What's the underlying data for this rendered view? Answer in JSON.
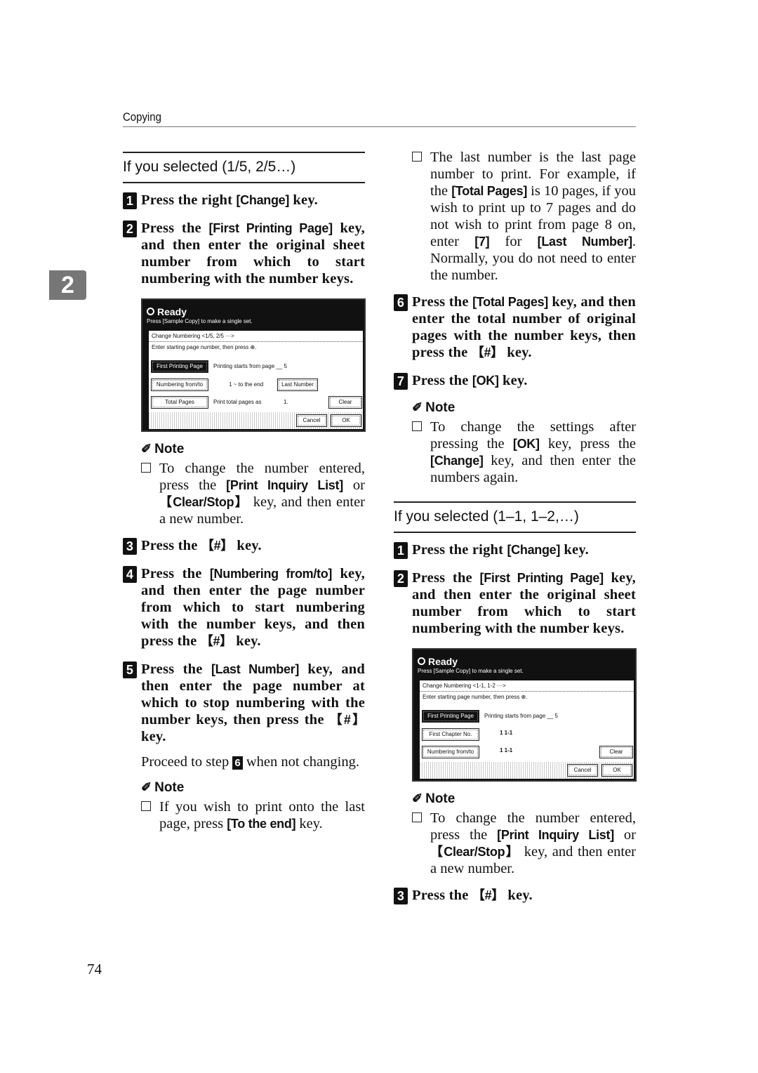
{
  "header": {
    "section": "Copying",
    "chapter_tab": "2",
    "page_number": "74"
  },
  "left": {
    "section_title": "If you selected (1/5, 2/5…)",
    "steps": [
      {
        "num": "1",
        "text": [
          {
            "t": "Press the right "
          },
          {
            "t": "[Change]",
            "k": 1
          },
          {
            "t": " key."
          }
        ]
      },
      {
        "num": "2",
        "text": [
          {
            "t": "Press the "
          },
          {
            "t": "[First Printing Page]",
            "k": 1
          },
          {
            "t": " key, and then enter the original sheet number from which to start numbering with the number keys."
          }
        ]
      }
    ],
    "screen": {
      "status": "Ready",
      "hint": "Press [Sample Copy] to make a single set.",
      "title": "Change Numbering   <1/5, 2/5 ···>",
      "instruction": "Enter starting page number, then press ⊕.",
      "btn_first": "First Printing Page",
      "start_text": "Printing starts from page  __ 5",
      "btn_numbering": "Numbering from/to",
      "range_text": "1  ~ to the end",
      "btn_last": "Last Number",
      "btn_total": "Total Pages",
      "total_text": "Print total pages as",
      "total_val": "1.",
      "btn_clear": "Clear",
      "btn_cancel": "Cancel",
      "btn_ok": "OK"
    },
    "note1": {
      "heading": "Note",
      "text": [
        {
          "t": "To change the number entered, press the "
        },
        {
          "t": "[Print Inquiry List]",
          "k": 1
        },
        {
          "t": " or "
        },
        {
          "t": "【Clear/Stop】",
          "k": 1
        },
        {
          "t": " key, and then enter a new number."
        }
      ]
    },
    "steps2": [
      {
        "num": "3",
        "text": [
          {
            "t": "Press the "
          },
          {
            "t": "【#】",
            "k": 1
          },
          {
            "t": " key."
          }
        ]
      },
      {
        "num": "4",
        "text": [
          {
            "t": "Press the "
          },
          {
            "t": "[Numbering from/to]",
            "k": 1
          },
          {
            "t": " key, and then enter the page number from which to start numbering with the number keys, and then press the "
          },
          {
            "t": "【#】",
            "k": 1
          },
          {
            "t": " key."
          }
        ]
      },
      {
        "num": "5",
        "text": [
          {
            "t": "Press the "
          },
          {
            "t": "[Last Number]",
            "k": 1
          },
          {
            "t": " key, and then enter the page number at which to stop numbering with the number keys, then press the "
          },
          {
            "t": "【#】",
            "k": 1
          },
          {
            "t": " key."
          }
        ]
      }
    ],
    "proceed": [
      {
        "t": "Proceed to step "
      },
      {
        "t": "6",
        "n": 1
      },
      {
        "t": " when not changing."
      }
    ],
    "note2": {
      "heading": "Note",
      "text": [
        {
          "t": "If you wish to print onto the last page, press "
        },
        {
          "t": "[To the end]",
          "k": 1
        },
        {
          "t": " key."
        }
      ]
    }
  },
  "right": {
    "bullet": [
      {
        "t": "The last number is the last page number to print. For example, if the "
      },
      {
        "t": "[Total Pages]",
        "k": 1
      },
      {
        "t": " is 10 pages, if you wish to print up to 7 pages and do not wish to print from page 8 on, enter "
      },
      {
        "t": "[7]",
        "k": 1
      },
      {
        "t": " for "
      },
      {
        "t": "[Last Number]",
        "k": 1
      },
      {
        "t": ". Normally, you do not need to enter the number."
      }
    ],
    "steps": [
      {
        "num": "6",
        "text": [
          {
            "t": "Press the "
          },
          {
            "t": "[Total Pages]",
            "k": 1
          },
          {
            "t": " key, and then enter the total number of original pages with the number keys, then press the "
          },
          {
            "t": "【#】",
            "k": 1
          },
          {
            "t": " key."
          }
        ]
      },
      {
        "num": "7",
        "text": [
          {
            "t": "Press the "
          },
          {
            "t": "[OK]",
            "k": 1
          },
          {
            "t": " key."
          }
        ]
      }
    ],
    "note1": {
      "heading": "Note",
      "text": [
        {
          "t": "To change the settings after pressing the "
        },
        {
          "t": "[OK]",
          "k": 1
        },
        {
          "t": " key, press the "
        },
        {
          "t": "[Change]",
          "k": 1
        },
        {
          "t": " key, and then enter the numbers again."
        }
      ]
    },
    "section_title": "If you selected (1–1, 1–2,…)",
    "steps2": [
      {
        "num": "1",
        "text": [
          {
            "t": "Press the right "
          },
          {
            "t": "[Change]",
            "k": 1
          },
          {
            "t": " key."
          }
        ]
      },
      {
        "num": "2",
        "text": [
          {
            "t": "Press the "
          },
          {
            "t": "[First Printing Page]",
            "k": 1
          },
          {
            "t": " key, and then enter the original sheet number from which to start numbering with the number keys."
          }
        ]
      }
    ],
    "screen": {
      "status": "Ready",
      "hint": "Press [Sample Copy] to make a single set.",
      "title": "Change Numbering   <1-1, 1-2 ···>",
      "instruction": "Enter starting page number, then press ⊕.",
      "btn_first": "First Printing Page",
      "start_text": "Printing starts from page  __ 5",
      "btn_chapter": "First Chapter No.",
      "chapter_text": "1    1-1",
      "btn_numbering": "Numbering from/to",
      "range_text": "1    1-1",
      "btn_clear": "Clear",
      "btn_cancel": "Cancel",
      "btn_ok": "OK"
    },
    "note2": {
      "heading": "Note",
      "text": [
        {
          "t": "To change the number entered, press the "
        },
        {
          "t": "[Print Inquiry List]",
          "k": 1
        },
        {
          "t": " or "
        },
        {
          "t": "【Clear/Stop】",
          "k": 1
        },
        {
          "t": " key, and then enter a new number."
        }
      ]
    },
    "steps3": [
      {
        "num": "3",
        "text": [
          {
            "t": "Press the "
          },
          {
            "t": "【#】",
            "k": 1
          },
          {
            "t": " key."
          }
        ]
      }
    ]
  }
}
